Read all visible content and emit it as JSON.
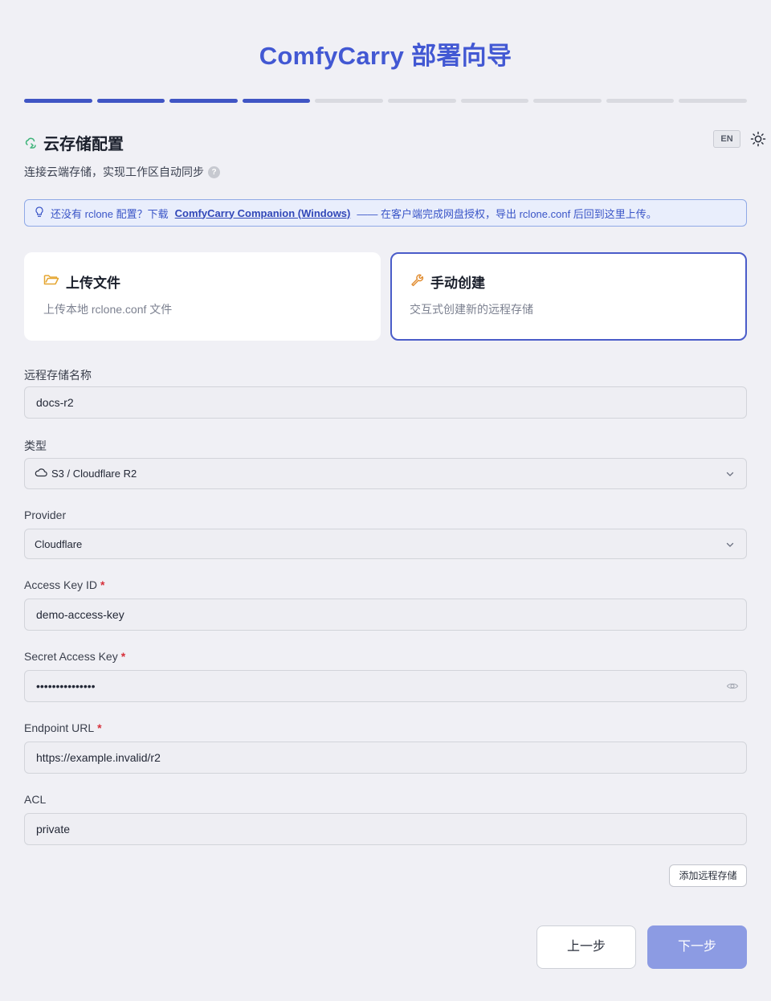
{
  "header": {
    "title": "ComfyCarry 部署向导"
  },
  "progress": {
    "total_steps": 10,
    "completed_steps": 4
  },
  "section": {
    "icon": "cloud-sync-icon",
    "title": "云存储配置",
    "subtitle": "连接云端存储，实现工作区自动同步",
    "help_glyph": "?",
    "lang_button": "EN",
    "theme_icon": "sun-icon"
  },
  "tip": {
    "icon": "lightbulb-icon",
    "text_before": "还没有 rclone 配置？下载",
    "link": "ComfyCarry Companion (Windows)",
    "text_after": "—— 在客户端完成网盘授权，导出 rclone.conf 后回到这里上传。"
  },
  "cards": {
    "upload": {
      "icon": "folder-open-icon",
      "title": "上传文件",
      "desc": "上传本地 rclone.conf 文件"
    },
    "manual": {
      "icon": "wrench-icon",
      "title": "手动创建",
      "desc": "交互式创建新的远程存储",
      "selected": true
    }
  },
  "form": {
    "remote_name": {
      "label": "远程存储名称",
      "value": "docs-r2"
    },
    "type": {
      "label": "类型",
      "value": "S3 / Cloudflare R2",
      "icon": "cloud-icon"
    },
    "provider": {
      "label": "Provider",
      "value": "Cloudflare"
    },
    "access_key": {
      "label": "Access Key ID",
      "required": "*",
      "value": "demo-access-key"
    },
    "secret_key": {
      "label": "Secret Access Key",
      "required": "*",
      "value": "•••••••••••••••",
      "toggle_icon": "eye-icon"
    },
    "endpoint": {
      "label": "Endpoint URL",
      "required": "*",
      "value": "https://example.invalid/r2"
    },
    "acl": {
      "label": "ACL",
      "value": "private"
    }
  },
  "actions": {
    "add_remote": "添加远程存储",
    "prev": "上一步",
    "next": "下一步"
  },
  "colors": {
    "accent": "#4258d3",
    "progress_done": "#4055c4",
    "next_button": "#8c9be3",
    "tip_border": "#8fa9e6"
  }
}
